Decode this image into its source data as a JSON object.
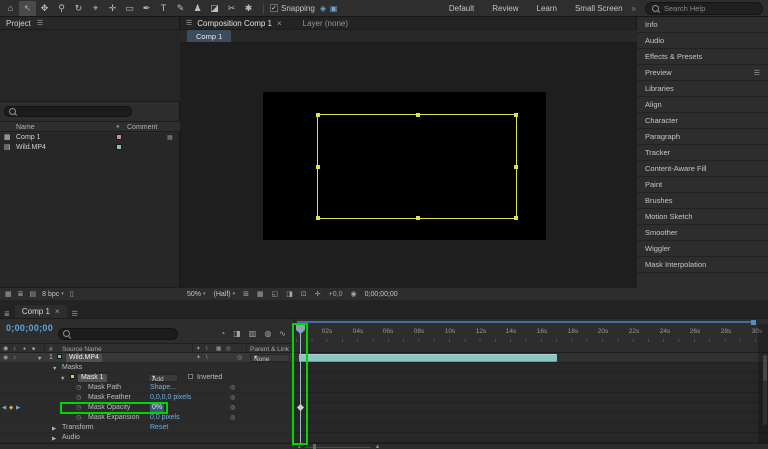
{
  "icons": {
    "menu": "☰",
    "grip": "≣",
    "close": "×",
    "dropdown": "▾",
    "chevrons": "»",
    "check": "✓",
    "home": "⌂",
    "selection": "↖",
    "hand": "✥",
    "zoom": "⚲",
    "orbit": "↻",
    "camera_tool": "⌖",
    "pan_behind": "✛",
    "shape": "▭",
    "pen": "✒",
    "type": "T",
    "brush": "✎",
    "clone_stamp": "♟",
    "eraser": "◪",
    "roto_brush": "✂",
    "puppet_pin": "✱",
    "snap_edge": "◈",
    "snap_feature": "▣",
    "comp_item": "▦",
    "footage_item": "▤",
    "swatch_header": "●",
    "grid_view": "▦",
    "list_view": "≣",
    "new_folder": "▤",
    "settings": "⚙",
    "trash": "▯",
    "safe_zones": "⊞",
    "grid": "▦",
    "mask_toggle": "◱",
    "channels": "◨",
    "region_of_interest": "⊡",
    "exposure_reset": "✛",
    "camera_snapshot": "◉",
    "eye": "◉",
    "audio_speaker": "♪",
    "solo": "●",
    "lock": "■",
    "mini_flowchart": "◔",
    "shy": "◨",
    "frame_blend": "▥",
    "motion_blur": "◍",
    "graph_editor": "∿",
    "expanded": "▼",
    "collapsed": "▶",
    "stopwatch": "◷",
    "pickwhip": "◎",
    "keyframe_prev": "◀",
    "keyframe": "◆",
    "keyframe_next": "▶",
    "switch_fx": "✦",
    "switch_slash": "/",
    "switch_quality": "\\",
    "zoom_out_mountain": "▴",
    "zoom_in_mountain": "▲"
  },
  "toolbar": {
    "snapping_label": "Snapping",
    "workspaces": [
      "Default",
      "Review",
      "Learn",
      "Small Screen"
    ],
    "search_placeholder": "Search Help"
  },
  "project": {
    "title": "Project",
    "columns": {
      "name": "Name",
      "comment": "Comment"
    },
    "items": [
      {
        "name": "Comp 1",
        "type": "comp",
        "label_color": "#cf8a8a"
      },
      {
        "name": "Wild.MP4",
        "type": "footage",
        "label_color": "#7fc2be"
      }
    ],
    "bit_depth": "8 bpc"
  },
  "viewer": {
    "tab_composition": "Composition Comp 1",
    "tab_layer": "Layer (none)",
    "comp_tab": "Comp 1",
    "zoom": "50%",
    "resolution": "(Half)",
    "exposure": "+0,0",
    "timecode": "0;00;00;00"
  },
  "sidebar": {
    "items": [
      {
        "label": "Info"
      },
      {
        "label": "Audio"
      },
      {
        "label": "Effects & Presets"
      },
      {
        "label": "Preview",
        "menu": true
      },
      {
        "label": "Libraries"
      },
      {
        "label": "Align"
      },
      {
        "label": "Character"
      },
      {
        "label": "Paragraph"
      },
      {
        "label": "Tracker"
      },
      {
        "label": "Content-Aware Fill"
      },
      {
        "label": "Paint"
      },
      {
        "label": "Brushes"
      },
      {
        "label": "Motion Sketch"
      },
      {
        "label": "Smoother"
      },
      {
        "label": "Wiggler"
      },
      {
        "label": "Mask Interpolation"
      }
    ]
  },
  "timeline": {
    "tab": "Comp 1",
    "timecode": "0;00;00;00",
    "columns": {
      "number": "#",
      "source_name": "Source Name",
      "parent": "Parent & Link"
    },
    "layer": {
      "number": "1",
      "name": "Wild.MP4",
      "parent_value": "None",
      "label_color": "#7fc2be"
    },
    "masks_group": "Masks",
    "mask": {
      "name": "Mask 1",
      "mode": "Add",
      "inverted": "Inverted",
      "swatch_color": "#d8d840"
    },
    "properties": [
      {
        "name": "Mask Path",
        "value": "Shape..."
      },
      {
        "name": "Mask Feather",
        "value": "0,0,0,0 pixels"
      },
      {
        "name": "Mask Opacity",
        "value": "0%"
      },
      {
        "name": "Mask Expansion",
        "value": "0,0 pixels"
      }
    ],
    "transform": {
      "name": "Transform",
      "value": "Reset"
    },
    "audio_group": "Audio",
    "ruler_ticks": [
      "02s",
      "04s",
      "06s",
      "08s",
      "10s",
      "12s",
      "14s",
      "16s",
      "18s",
      "20s",
      "22s",
      "24s",
      "26s",
      "28s",
      "30s"
    ]
  },
  "colors": {
    "annotation_green": "#00d600",
    "layer_bar_teal": "#8cc6c2",
    "mask_yellow": "#e2e24e",
    "timecode_blue": "#5fa3dc",
    "value_blue": "#6fb1e0"
  }
}
